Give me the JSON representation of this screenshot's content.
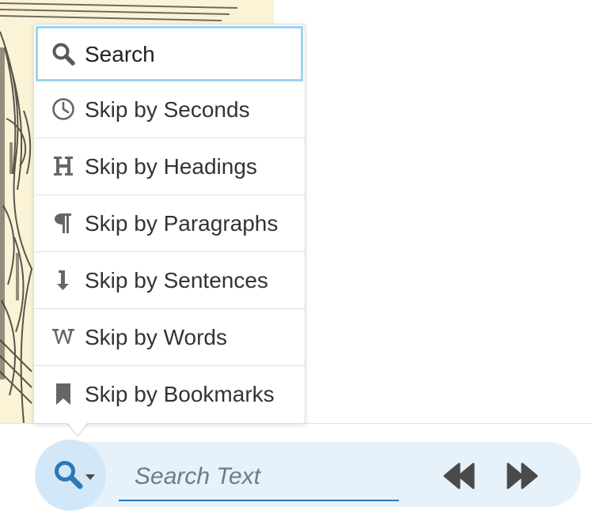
{
  "menu": {
    "items": [
      {
        "label": "Search",
        "icon": "search-icon",
        "selected": true
      },
      {
        "label": "Skip by Seconds",
        "icon": "clock-icon"
      },
      {
        "label": "Skip by Headings",
        "icon": "heading-icon"
      },
      {
        "label": "Skip by Paragraphs",
        "icon": "paragraph-icon"
      },
      {
        "label": "Skip by Sentences",
        "icon": "sentence-arrow-icon"
      },
      {
        "label": "Skip by Words",
        "icon": "word-icon"
      },
      {
        "label": "Skip by Bookmarks",
        "icon": "bookmark-icon"
      }
    ]
  },
  "toolbar": {
    "search_placeholder": "Search Text",
    "mode_icon": "search-icon",
    "prev_icon": "rewind-icon",
    "next_icon": "fast-forward-icon"
  },
  "colors": {
    "accent": "#2b79b8",
    "selected_border": "#9fd4ee",
    "toolbar_bg": "#e6f1fa",
    "mode_button_bg": "#d2e7f7",
    "icon_gray": "#666666"
  }
}
